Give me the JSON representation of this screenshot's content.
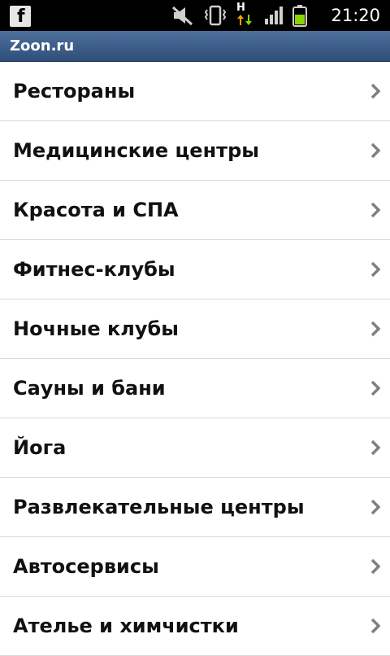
{
  "status_bar": {
    "time": "21:20",
    "network_type": "H",
    "icons": [
      "facebook-icon",
      "mute-icon",
      "vibrate-icon",
      "network-arrows-icon",
      "signal-icon",
      "battery-icon"
    ]
  },
  "app": {
    "title": "Zoon.ru"
  },
  "categories": [
    {
      "label": "Рестораны"
    },
    {
      "label": "Медицинские центры"
    },
    {
      "label": "Красота и СПА"
    },
    {
      "label": "Фитнес-клубы"
    },
    {
      "label": "Ночные клубы"
    },
    {
      "label": "Сауны и бани"
    },
    {
      "label": "Йога"
    },
    {
      "label": "Развлекательные центры"
    },
    {
      "label": "Автосервисы"
    },
    {
      "label": "Ателье и химчистки"
    }
  ],
  "colors": {
    "title_bar": "#3d5f8c",
    "battery": "#8cd400",
    "network_arrow_up": "#8cd400",
    "network_arrow_down": "#f0a000",
    "chevron": "#808080"
  }
}
